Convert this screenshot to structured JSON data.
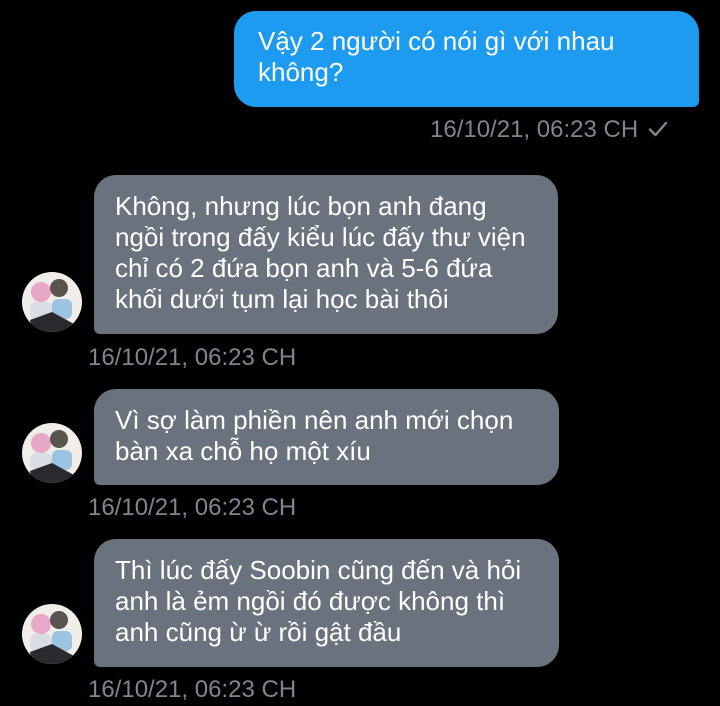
{
  "messages": [
    {
      "direction": "outgoing",
      "lines": [
        "Vậy 2 người có nói gì với nhau",
        "không?"
      ],
      "timestamp": "16/10/21, 06:23 CH",
      "status_icon": "check-icon"
    },
    {
      "direction": "incoming",
      "avatar_icon": "avatar-image",
      "lines": [
        "Không, nhưng lúc bọn anh đang",
        "ngồi trong đấy kiểu lúc đấy thư viện",
        "chỉ có 2 đứa bọn anh và 5-6 đứa",
        "khối dưới tụm lại học bài thôi"
      ],
      "timestamp": "16/10/21, 06:23 CH"
    },
    {
      "direction": "incoming",
      "avatar_icon": "avatar-image",
      "lines": [
        "Vì sợ làm phiền nên anh mới chọn",
        "bàn xa chỗ họ một xíu"
      ],
      "timestamp": "16/10/21, 06:23 CH"
    },
    {
      "direction": "incoming",
      "avatar_icon": "avatar-image",
      "lines": [
        "Thì lúc đấy Soobin cũng đến và hỏi",
        "anh là ẻm ngồi đó được không thì",
        "anh cũng ừ ừ rồi gật đầu"
      ],
      "timestamp": "16/10/21, 06:23 CH"
    }
  ],
  "colors": {
    "background": "#000000",
    "outgoing_bubble": "#1d9bf0",
    "incoming_bubble": "#6a737d",
    "timestamp": "#7d8690",
    "text": "#ffffff"
  }
}
